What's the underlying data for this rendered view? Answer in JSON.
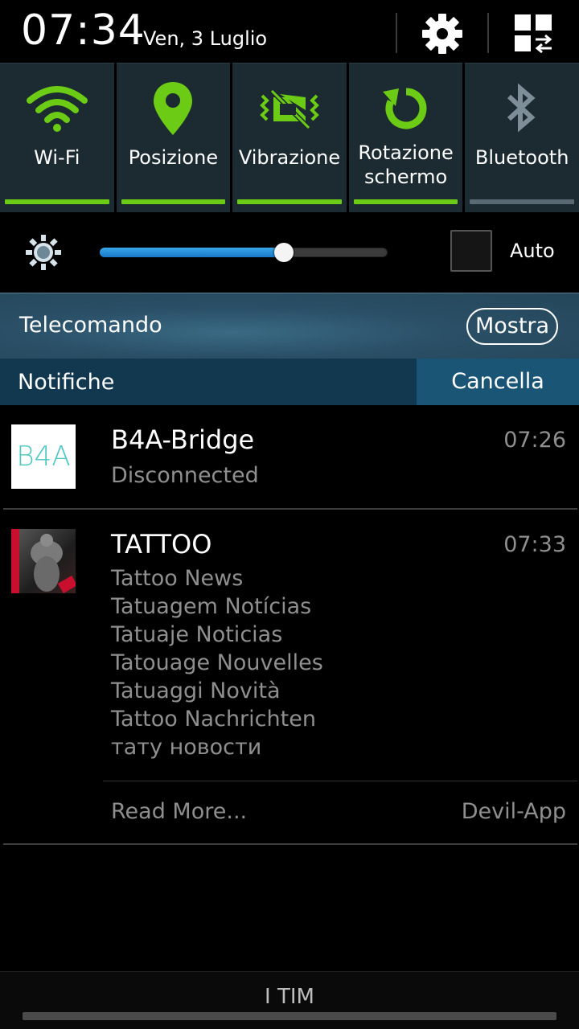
{
  "header": {
    "time": "07:34",
    "date": "Ven, 3 Luglio",
    "settings_icon": "gear-icon",
    "grid_icon": "grid-switch-icon"
  },
  "toggles": [
    {
      "label": "Wi-Fi",
      "icon": "wifi-icon",
      "active": true
    },
    {
      "label": "Posizione",
      "icon": "location-pin-icon",
      "active": true
    },
    {
      "label": "Vibrazione",
      "icon": "vibration-icon",
      "active": true
    },
    {
      "label": "Rotazione\nschermo",
      "line1": "Rotazione",
      "line2": "schermo",
      "icon": "rotate-icon",
      "active": true
    },
    {
      "label": "Bluetooth",
      "icon": "bluetooth-icon",
      "active": false
    }
  ],
  "brightness": {
    "level": 0.64,
    "auto_label": "Auto",
    "auto_checked": false
  },
  "remote": {
    "label": "Telecomando",
    "button": "Mostra"
  },
  "notifications_bar": {
    "label": "Notifiche",
    "clear_button": "Cancella"
  },
  "notifications": [
    {
      "app_icon_text": "B4A",
      "title": "B4A-Bridge",
      "time": "07:26",
      "subtitle": "Disconnected"
    },
    {
      "title": "TATTOO",
      "time": "07:33",
      "lines": [
        "Tattoo News",
        "Tatuagem Notícias",
        "Tatuaje Noticias",
        "Tatouage Nouvelles",
        "Tatuaggi Novità",
        "Tattoo Nachrichten",
        "тату новости"
      ],
      "action": "Read More...",
      "source": "Devil-App"
    }
  ],
  "carrier": "I TIM",
  "colors": {
    "accent_green": "#6ccb14",
    "toggle_bg": "#1c2a31",
    "notif_bar": "#11384e",
    "cancel_bg": "#1a5576"
  }
}
